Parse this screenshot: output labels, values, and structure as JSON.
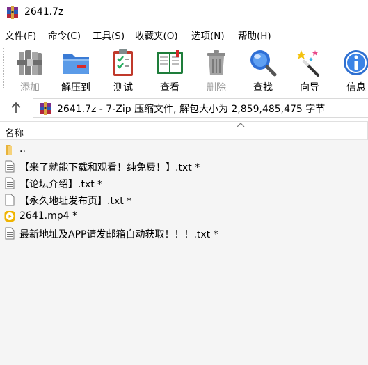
{
  "window": {
    "title": "2641.7z"
  },
  "menu": [
    "文件(F)",
    "命令(C)",
    "工具(S)",
    "收藏夹(O)",
    "选项(N)",
    "帮助(H)"
  ],
  "toolbar": {
    "add": "添加",
    "extract": "解压到",
    "test": "测试",
    "view": "查看",
    "delete": "删除",
    "find": "查找",
    "wizard": "向导",
    "info": "信息"
  },
  "address": {
    "text": "2641.7z - 7-Zip 压缩文件, 解包大小为 2,859,485,475 字节"
  },
  "list": {
    "header_name": "名称",
    "rows": [
      {
        "name": "..",
        "icon": "folder-up-icon"
      },
      {
        "name": "【来了就能下载和观看！纯免费！】.txt *",
        "icon": "text-file-icon"
      },
      {
        "name": "【论坛介绍】.txt *",
        "icon": "text-file-icon"
      },
      {
        "name": "【永久地址发布页】.txt *",
        "icon": "text-file-icon"
      },
      {
        "name": "2641.mp4 *",
        "icon": "video-file-icon"
      },
      {
        "name": "最新地址及APP请发邮箱自动获取！！！.txt *",
        "icon": "text-file-icon"
      }
    ]
  },
  "colors": {
    "winrar_red": "#b3263a",
    "winrar_blue": "#2a5bb8",
    "folder_yellow": "#f1c54a",
    "video_orange": "#f0b400"
  }
}
